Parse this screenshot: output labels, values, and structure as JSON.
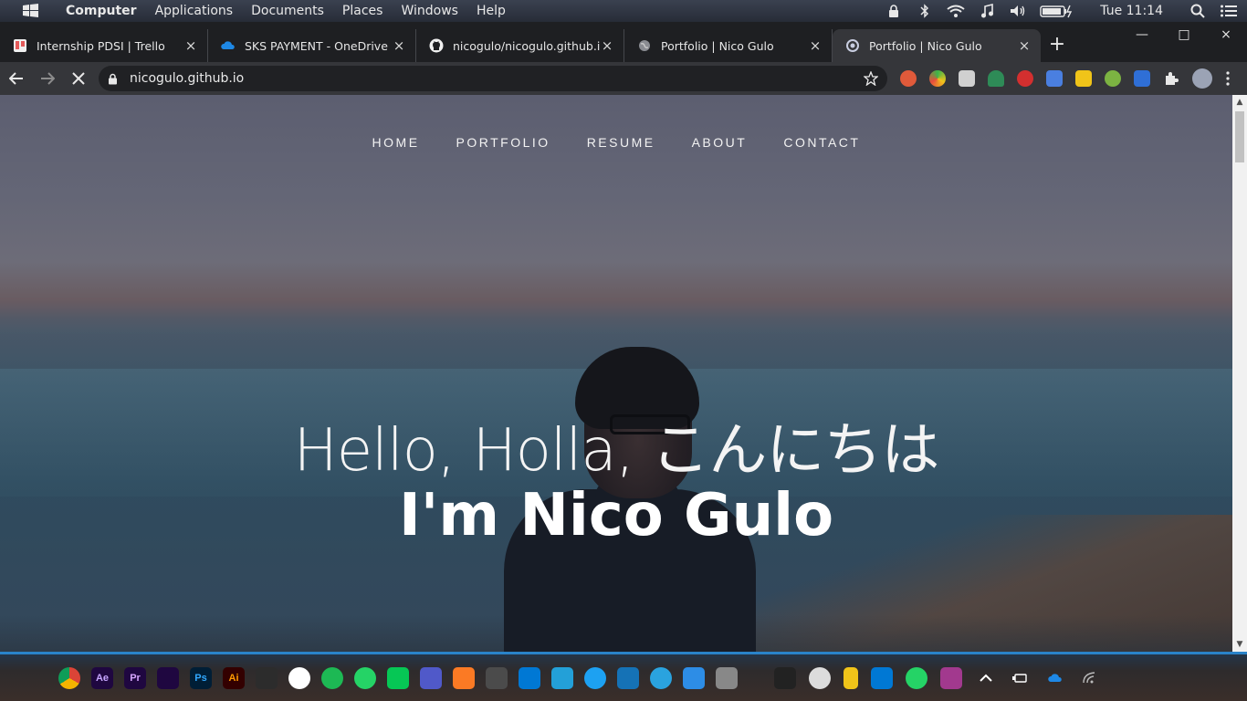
{
  "system_bar": {
    "menus": [
      "Computer",
      "Applications",
      "Documents",
      "Places",
      "Windows",
      "Help"
    ],
    "clock": "Tue 11:14",
    "icons": [
      "lock-icon",
      "bluetooth-icon",
      "wifi-icon",
      "music-icon",
      "volume-icon",
      "battery-icon",
      "search-icon",
      "menu-icon"
    ]
  },
  "tabs": [
    {
      "title": "Internship PDSI | Trello",
      "favicon": "trello-icon",
      "close": "×"
    },
    {
      "title": "SKS PAYMENT - OneDrive",
      "favicon": "onedrive-icon",
      "close": "×"
    },
    {
      "title": "nicogulo/nicogulo.github.io",
      "favicon": "github-icon",
      "close": "×"
    },
    {
      "title": "Portfolio | Nico Gulo",
      "favicon": "globe-icon",
      "close": "×"
    },
    {
      "title": "Portfolio | Nico Gulo",
      "favicon": "loading-icon",
      "close": "×",
      "active": true
    }
  ],
  "new_tab": "+",
  "window_controls": {
    "minimize": "—",
    "maximize": "□",
    "close": "×"
  },
  "toolbar": {
    "url": "nicogulo.github.io"
  },
  "page": {
    "nav": [
      "HOME",
      "PORTFOLIO",
      "RESUME",
      "ABOUT",
      "CONTACT"
    ],
    "greeting": "Hello, Holla, こんにちは",
    "name": "I'm Nico Gulo"
  },
  "colors": {
    "accent": "#2a83c9",
    "tab_active": "#35363a",
    "tab_strip": "#1e1f22"
  }
}
